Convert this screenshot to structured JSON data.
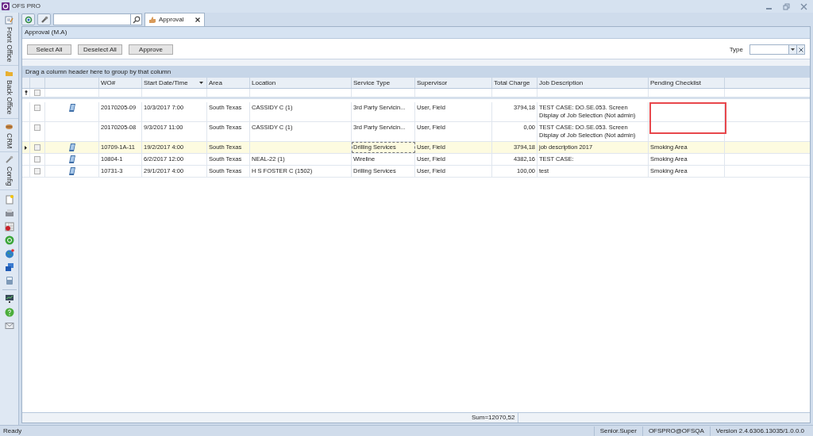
{
  "window": {
    "title": "OFS PRO"
  },
  "nav_tabs": [
    {
      "label": "Front Office"
    },
    {
      "label": "Back Office"
    },
    {
      "label": "CRM"
    },
    {
      "label": "Config"
    }
  ],
  "tabs": [
    {
      "label": "Approval",
      "selected": true
    }
  ],
  "panel": {
    "title": "Approval (M.A)"
  },
  "buttons": [
    "Select All",
    "Deselect All",
    "Approve"
  ],
  "type_filter": {
    "label": "Type"
  },
  "group_panel": "Drag a column header here to group by that column",
  "table": {
    "filter_row": {
      "checked": false
    },
    "columns": [
      {
        "label": "WO#",
        "sorted": false
      },
      {
        "label": "Start Date/Time",
        "sorted": true
      },
      {
        "label": "Area",
        "sorted": false
      },
      {
        "label": "Location",
        "sorted": false
      },
      {
        "label": "Service Type",
        "sorted": false
      },
      {
        "label": "Supervisor",
        "sorted": false
      },
      {
        "label": "Total Charge",
        "sorted": false
      },
      {
        "label": "Job Description",
        "sorted": false
      },
      {
        "label": "Pending Checklist",
        "sorted": false
      }
    ],
    "rows": [
      {
        "selected": false,
        "checked": false,
        "device_icon": true,
        "cells": [
          "20170205-09",
          "10/3/2017 7:00",
          "South Texas",
          "CASSIDY C (1)",
          "3rd Party Servicin...",
          "User, Field",
          "3794,18",
          "TEST CASE: DO.SE.053. Screen Display  of Job Selection (Not admin)",
          ""
        ]
      },
      {
        "selected": false,
        "checked": false,
        "device_icon": false,
        "cells": [
          "20170205-08",
          "9/3/2017 11:00",
          "South Texas",
          "CASSIDY C (1)",
          "3rd Party Servicin...",
          "User, Field",
          "0,00",
          "TEST CASE: DO.SE.053. Screen Display  of Job Selection (Not admin)",
          ""
        ]
      },
      {
        "selected": true,
        "checked": false,
        "device_icon": true,
        "cells": [
          "10709-1A-11",
          "19/2/2017 4:00",
          "South Texas",
          "",
          "Drilling Services",
          "User, Field",
          "3794,18",
          "job description 2017",
          "Smoking Area"
        ]
      },
      {
        "selected": false,
        "checked": false,
        "device_icon": true,
        "cells": [
          "10804-1",
          "6/2/2017 12:00",
          "South Texas",
          "NEAL-22 (1)",
          "Wireline",
          "User, Field",
          "4382,16",
          "TEST CASE:",
          "Smoking Area"
        ]
      },
      {
        "selected": false,
        "checked": false,
        "device_icon": true,
        "cells": [
          "10731-3",
          "29/1/2017 4:00",
          "South Texas",
          "H S FOSTER C (1502)",
          "Drilling Services",
          "User, Field",
          "100,00",
          "test",
          "Smoking Area"
        ]
      }
    ],
    "summary": "Sum=12070,52"
  },
  "status_bar": {
    "left": "Ready",
    "items": [
      "Senior.Super",
      "OFSPRO@OFSQA",
      "Version 2.4.6306.13035/1.0.0.0"
    ]
  }
}
